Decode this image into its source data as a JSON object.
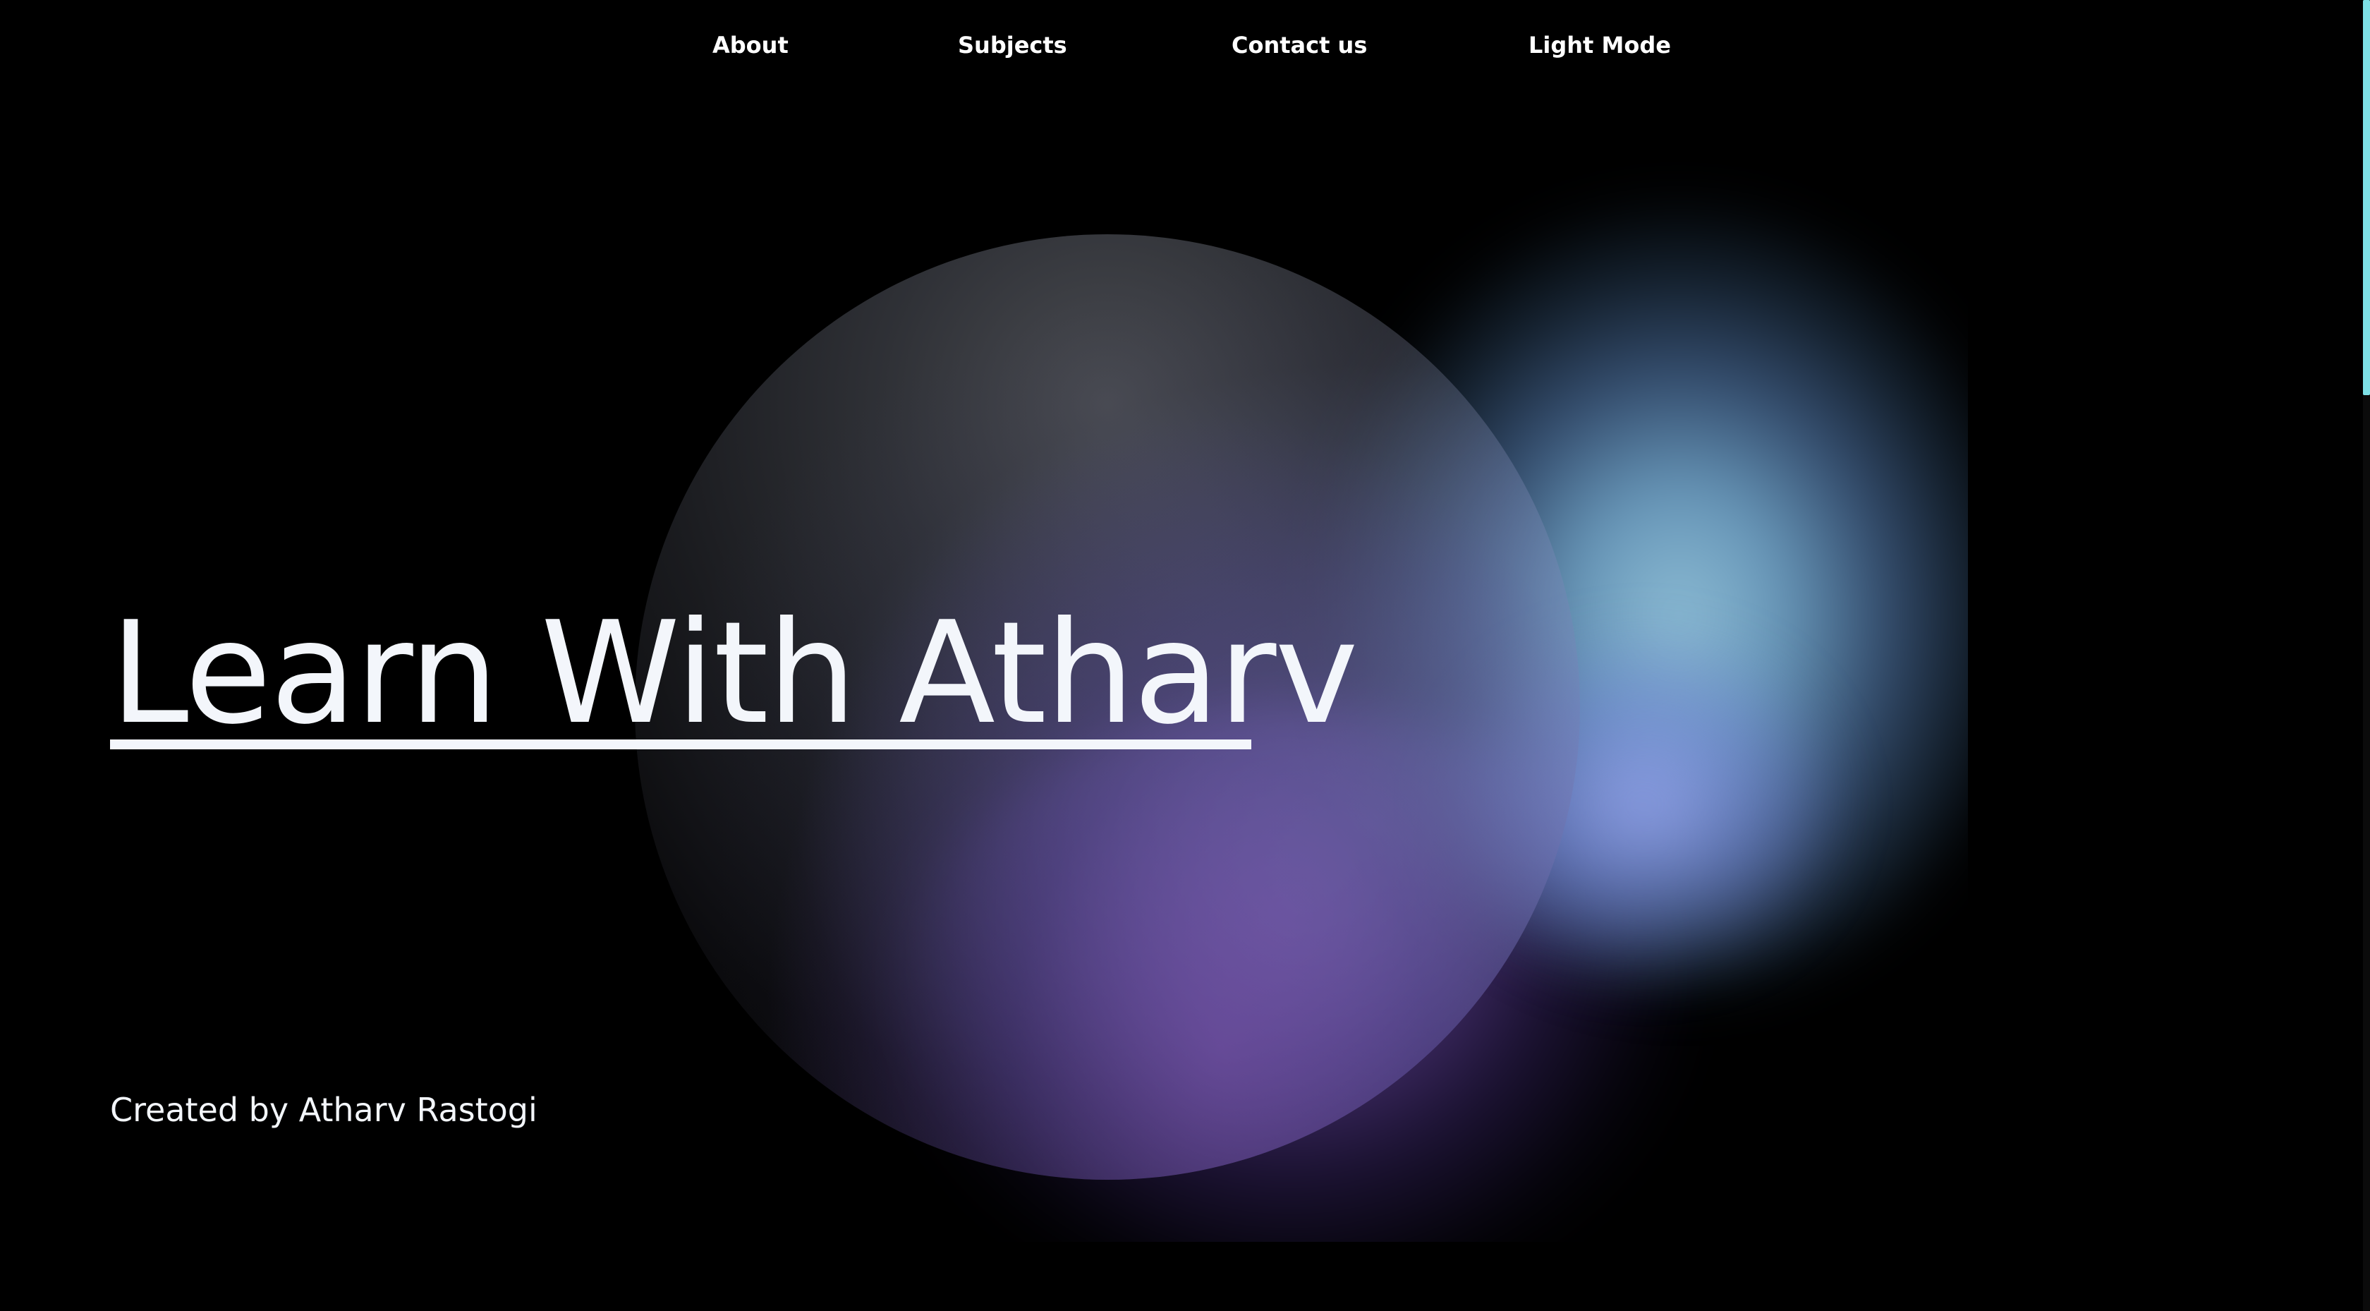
{
  "nav": {
    "items": [
      {
        "label": "About"
      },
      {
        "label": "Subjects"
      },
      {
        "label": "Contact us"
      },
      {
        "label": "Light Mode"
      }
    ]
  },
  "hero": {
    "title": "Learn With Atharv",
    "credit": "Created by Atharv Rastogi"
  },
  "colors": {
    "background": "#000000",
    "text": "#f3f6fb",
    "glow_cyan": "#8fb8d8",
    "glow_purple": "#6a4a9a",
    "scrollbar_thumb": "#7de0e6"
  },
  "theme": "dark"
}
